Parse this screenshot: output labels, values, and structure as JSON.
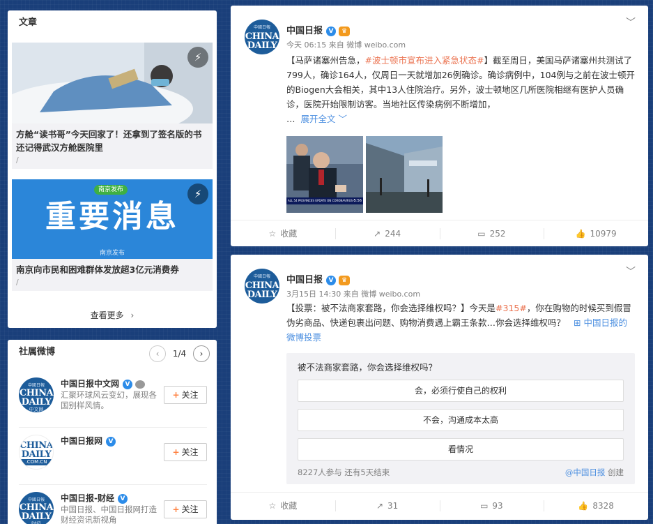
{
  "articles_card": {
    "title": "文章",
    "items": [
      {
        "title": "方舱“读书哥”今天回家了！还拿到了签名版的书还记得武汉方舱医院里",
        "slash": "/"
      },
      {
        "title": "南京向市民和困难群体发放超3亿元消费券",
        "slash": "/",
        "thumb_source": "南京发布",
        "thumb_big": "重要消息",
        "thumb_badge": "南京发布"
      }
    ],
    "see_more": "查看更多"
  },
  "related_card": {
    "title": "社属微博",
    "pager": "1/4",
    "accounts": [
      {
        "name": "中国日报中文网",
        "desc": "汇聚环球风云变幻，展现各国别样风情。",
        "avatar_sub": "中文网",
        "follow": "关注"
      },
      {
        "name": "中国日报网",
        "desc": "",
        "avatar_sub": ".COM.CN",
        "follow": "关注"
      },
      {
        "name": "中国日报-财经",
        "desc": "中国日报、中国日报网打造财经资讯新视角",
        "avatar_sub": "财经",
        "follow": "关注"
      }
    ]
  },
  "avatar": {
    "small": "中國日報",
    "big1": "CHINA",
    "big2": "DAILY"
  },
  "posts": [
    {
      "author": "中国日报",
      "meta_time": "今天 06:15",
      "meta_from": "来自",
      "meta_client": "微博 weibo.com",
      "text_prefix": "【马萨诸塞州告急，",
      "text_tag": "#波士顿市宣布进入紧急状态#",
      "text_rest": "】截至周日，美国马萨诸塞州共测试了799人，确诊164人，仅周日一天就增加26例确诊。确诊病例中，104例与之前在波士顿开的Biogen大会相关，其中13人住院治疗。另外，波士顿地区几所医院相继有医护人员确诊，医院开始限制访客。当地社区传染病例不断增加，",
      "ellipsis": "…",
      "expand": "展开全文",
      "image1_caption": "ALL 54 PROVINCES UPDATE ON CORONAVIRUS OUTBREAK",
      "image1_time": "5:56",
      "actions": {
        "collect": "收藏",
        "repost": "244",
        "comment": "252",
        "like": "10979"
      }
    },
    {
      "author": "中国日报",
      "meta_time": "3月15日 14:30",
      "meta_from": "来自",
      "meta_client": "微博 weibo.com",
      "text_prefix": "【投票：被不法商家套路，你会选择维权吗？】今天是",
      "text_tag": "#315#",
      "text_rest": "，你在购物的时候买到假冒伪劣商品、快递包裹出问题、购物消费遇上霸王条款…你会选择维权吗？",
      "poll_link": "中国日报的微博投票",
      "poll": {
        "question": "被不法商家套路，你会选择维权吗？",
        "options": [
          "会，必须行使自己的权利",
          "不会，沟通成本太高",
          "看情况"
        ],
        "footer": "8227人参与 还有5天结束",
        "creator": "@中国日报",
        "created": "创建"
      },
      "actions": {
        "collect": "收藏",
        "repost": "31",
        "comment": "93",
        "like": "8328"
      }
    }
  ]
}
